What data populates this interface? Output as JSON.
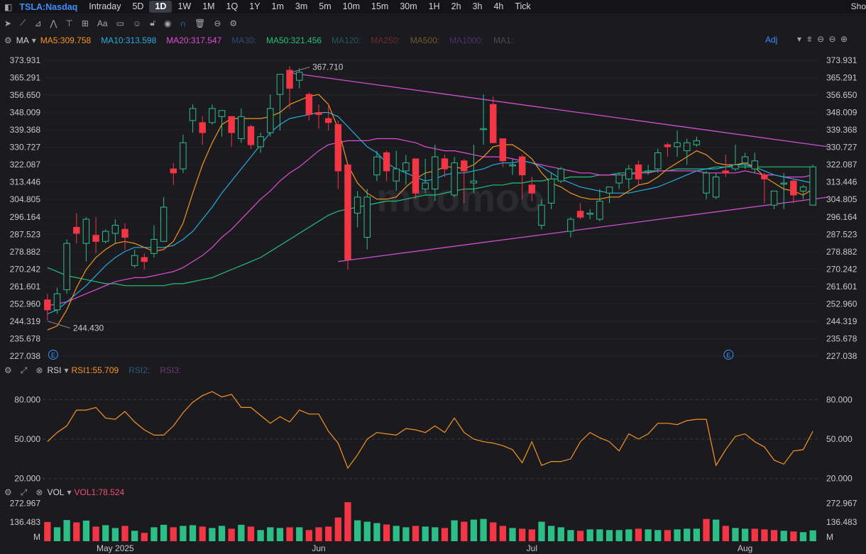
{
  "header": {
    "symbol": "TSLA:Nasdaq",
    "timeframes": [
      "Intraday",
      "5D",
      "1D",
      "1W",
      "1M",
      "1Q",
      "1Y",
      "1m",
      "3m",
      "5m",
      "10m",
      "15m",
      "30m",
      "1H",
      "2h",
      "3h",
      "4h",
      "Tick"
    ],
    "active_timeframe": "1D",
    "right_text": "Sho"
  },
  "toolbar_icons": [
    "cursor-icon",
    "line-draw-icon",
    "fib-icon",
    "pattern-icon",
    "measure-icon",
    "text-icon",
    "note-icon",
    "smile-icon",
    "lock-icon",
    "eye-icon",
    "magnet-icon",
    "trash-icon",
    "link-icon",
    "settings-icon"
  ],
  "toolbar_text_label": "Aa",
  "ma_bar": {
    "name": "MA",
    "items": [
      {
        "label": "MA5:309.758",
        "color": "#f7931e"
      },
      {
        "label": "MA10:313.598",
        "color": "#29a9e0"
      },
      {
        "label": "MA20:317.547",
        "color": "#e24bd8"
      },
      {
        "label": "MA30:",
        "color": "#2c4a78"
      },
      {
        "label": "MA50:321.456",
        "color": "#22c07a"
      },
      {
        "label": "MA120:",
        "color": "#1f5a57"
      },
      {
        "label": "MA250:",
        "color": "#6a2b2b"
      },
      {
        "label": "MA500:",
        "color": "#6b5a28"
      },
      {
        "label": "MA1000:",
        "color": "#4a2f6e"
      },
      {
        "label": "MA1:",
        "color": "#4a4a50"
      }
    ],
    "adj_label": "Adj"
  },
  "rsi_bar": {
    "name": "RSI",
    "items": [
      {
        "label": "RSI1:55.709",
        "color": "#f7931e"
      },
      {
        "label": "RSI2:",
        "color": "#2c5a7a"
      },
      {
        "label": "RSI3:",
        "color": "#6a3a6a"
      }
    ]
  },
  "vol_bar": {
    "name": "VOL",
    "items": [
      {
        "label": "VOL1:78.524",
        "color": "#f0506e"
      }
    ]
  },
  "watermark": "moomoo",
  "event_marker": "E",
  "chart_data": {
    "type": "candlestick",
    "price_axis_ticks": [
      "373.931",
      "365.291",
      "356.650",
      "348.009",
      "339.368",
      "330.727",
      "322.087",
      "313.446",
      "304.805",
      "296.164",
      "287.523",
      "278.882",
      "270.242",
      "261.601",
      "252.960",
      "244.319",
      "235.678",
      "227.038"
    ],
    "price_range": [
      227.038,
      373.931
    ],
    "annotations": {
      "high_label": "367.710",
      "low_label": "244.430"
    },
    "x_labels": [
      "May 2025",
      "Jun",
      "Jul",
      "Aug"
    ],
    "colors": {
      "up": "#2dbd86",
      "down": "#f23645",
      "ma5": "#f7931e",
      "ma10": "#29a9e0",
      "ma20": "#e24bd8",
      "ma50": "#22c07a",
      "trend": "#d04fd4"
    },
    "candles": [
      [
        255,
        250,
        258,
        245
      ],
      [
        250,
        258,
        261,
        248
      ],
      [
        260,
        283,
        285,
        258
      ],
      [
        291,
        288,
        298,
        283
      ],
      [
        283,
        295,
        296,
        274
      ],
      [
        287,
        284,
        296,
        278
      ],
      [
        284,
        289,
        290,
        283
      ],
      [
        288,
        292,
        295,
        283
      ],
      [
        290,
        286,
        293,
        280
      ],
      [
        272,
        277,
        280,
        271
      ],
      [
        276,
        274,
        278,
        270
      ],
      [
        278,
        285,
        292,
        276
      ],
      [
        284,
        301,
        306,
        284
      ],
      [
        320,
        318,
        323,
        312
      ],
      [
        320,
        333,
        337,
        318
      ],
      [
        344,
        350,
        352,
        338
      ],
      [
        343,
        338,
        346,
        332
      ],
      [
        343,
        350,
        352,
        342
      ],
      [
        346,
        349,
        349,
        336
      ],
      [
        346,
        338,
        345,
        331
      ],
      [
        335,
        346,
        350,
        333
      ],
      [
        341,
        332,
        342,
        330
      ],
      [
        331,
        336,
        338,
        328
      ],
      [
        338,
        350,
        357,
        336
      ],
      [
        357,
        367,
        367,
        339
      ],
      [
        369,
        360,
        371,
        350
      ],
      [
        364,
        368,
        370,
        360
      ],
      [
        357,
        347,
        358,
        344
      ],
      [
        348,
        347,
        352,
        340
      ],
      [
        345,
        343,
        352,
        339
      ],
      [
        342,
        319,
        344,
        310
      ],
      [
        322,
        275,
        322,
        270
      ],
      [
        298,
        306,
        309,
        291
      ],
      [
        286,
        306,
        310,
        280
      ],
      [
        317,
        326,
        329,
        314
      ],
      [
        328,
        319,
        329,
        314
      ],
      [
        314,
        320,
        329,
        309
      ],
      [
        319,
        323,
        327,
        312
      ],
      [
        325,
        308,
        325,
        305
      ],
      [
        310,
        313,
        325,
        308
      ],
      [
        310,
        326,
        332,
        304
      ],
      [
        325,
        320,
        327,
        316
      ],
      [
        307,
        323,
        326,
        306
      ],
      [
        324,
        319,
        325,
        303
      ],
      [
        313,
        314,
        332,
        308
      ],
      [
        340,
        340,
        357,
        332
      ],
      [
        352,
        333,
        356,
        333
      ],
      [
        335,
        324,
        335,
        321
      ],
      [
        322,
        322,
        325,
        317
      ],
      [
        326,
        317,
        327,
        305
      ],
      [
        312,
        308,
        316,
        304
      ],
      [
        292,
        302,
        305,
        290
      ],
      [
        303,
        315,
        318,
        300
      ],
      [
        314,
        320,
        321,
        313
      ],
      [
        289,
        295,
        296,
        286
      ],
      [
        299,
        296,
        303,
        295
      ],
      [
        298,
        298,
        300,
        295
      ],
      [
        295,
        304,
        310,
        294
      ],
      [
        308,
        311,
        311,
        303
      ],
      [
        313,
        317,
        318,
        310
      ],
      [
        315,
        320,
        322,
        310
      ],
      [
        322,
        315,
        324,
        312
      ],
      [
        319,
        319,
        322,
        317
      ],
      [
        320,
        328,
        330,
        318
      ],
      [
        332,
        331,
        333,
        326
      ],
      [
        331,
        333,
        339,
        326
      ],
      [
        329,
        333,
        335,
        322
      ],
      [
        332,
        334,
        336,
        331
      ],
      [
        308,
        318,
        319,
        305
      ],
      [
        306,
        316,
        318,
        305
      ],
      [
        319,
        318,
        327,
        316
      ],
      [
        320,
        322,
        332,
        319
      ],
      [
        323,
        326,
        328,
        320
      ],
      [
        320,
        324,
        328,
        318
      ],
      [
        317,
        315,
        318,
        303
      ],
      [
        302,
        309,
        309,
        300
      ],
      [
        313,
        313,
        318,
        300
      ],
      [
        314,
        307,
        315,
        303
      ],
      [
        309,
        311,
        312,
        305
      ],
      [
        302,
        321,
        322,
        302
      ]
    ],
    "ma_series": {
      "ma5": [
        240,
        242,
        250,
        261,
        270,
        276,
        280,
        283,
        284,
        283,
        281,
        279,
        280,
        284,
        293,
        308,
        322,
        333,
        342,
        345,
        345,
        345,
        345,
        346,
        348,
        352,
        354,
        356,
        357,
        352,
        340,
        322,
        313,
        308,
        305,
        305,
        306,
        311,
        315,
        318,
        319,
        321,
        321,
        320,
        322,
        326,
        331,
        332,
        332,
        329,
        325,
        318,
        313,
        311,
        308,
        306,
        305,
        305,
        306,
        306,
        309,
        312,
        313,
        316,
        320,
        323,
        326,
        329,
        327,
        323,
        322,
        322,
        323,
        321,
        316,
        313,
        310,
        309,
        307,
        310
      ],
      "ma10": [
        248,
        250,
        254,
        258,
        262,
        267,
        272,
        276,
        279,
        281,
        281,
        281,
        281,
        282,
        285,
        289,
        295,
        301,
        308,
        314,
        320,
        326,
        332,
        338,
        342,
        345,
        346,
        347,
        348,
        348,
        346,
        341,
        336,
        331,
        328,
        323,
        320,
        318,
        316,
        314,
        315,
        317,
        318,
        318,
        319,
        320,
        322,
        323,
        323,
        324,
        323,
        321,
        318,
        315,
        313,
        311,
        310,
        309,
        308,
        308,
        308,
        309,
        310,
        311,
        313,
        315,
        317,
        319,
        320,
        320,
        321,
        322,
        322,
        321,
        319,
        317,
        316,
        315,
        314,
        313
      ],
      "ma20": [
        252,
        253,
        254,
        256,
        258,
        260,
        262,
        264,
        265,
        266,
        266,
        267,
        268,
        269,
        271,
        274,
        277,
        281,
        286,
        290,
        295,
        300,
        305,
        309,
        314,
        318,
        321,
        325,
        329,
        332,
        333,
        334,
        334,
        334,
        335,
        335,
        335,
        334,
        333,
        331,
        330,
        329,
        329,
        328,
        327,
        326,
        326,
        326,
        325,
        324,
        323,
        322,
        321,
        320,
        319,
        318,
        318,
        317,
        317,
        317,
        317,
        318,
        318,
        319,
        319,
        319,
        319,
        319,
        318,
        318,
        318,
        318,
        319,
        318,
        317,
        317,
        316,
        316,
        316,
        317
      ],
      "ma50": [
        271,
        269,
        267,
        266,
        265,
        264,
        263,
        263,
        262,
        262,
        262,
        262,
        262,
        263,
        263,
        264,
        265,
        266,
        268,
        270,
        272,
        274,
        276,
        279,
        282,
        285,
        288,
        291,
        294,
        297,
        299,
        300,
        301,
        302,
        303,
        304,
        304,
        305,
        306,
        307,
        307,
        308,
        309,
        310,
        310,
        311,
        312,
        312,
        313,
        313,
        314,
        314,
        315,
        315,
        316,
        316,
        316,
        317,
        317,
        318,
        318,
        318,
        319,
        319,
        319,
        320,
        320,
        320,
        320,
        321,
        321,
        321,
        321,
        321,
        321,
        321,
        321,
        321,
        321,
        321
      ]
    },
    "trendlines": [
      {
        "from": [
          25,
          367.71
        ],
        "to": [
          80,
          331.0
        ]
      },
      {
        "from": [
          30,
          274.0
        ],
        "to": [
          80,
          306.0
        ]
      }
    ],
    "rsi": {
      "ticks": [
        "80.000",
        "50.000",
        "20.000"
      ],
      "range": [
        15,
        92
      ],
      "values": [
        48,
        55,
        60,
        72,
        72,
        74,
        66,
        65,
        71,
        63,
        57,
        53,
        53,
        60,
        70,
        78,
        83,
        86,
        82,
        84,
        74,
        74,
        68,
        62,
        67,
        63,
        72,
        69,
        69,
        56,
        47,
        28,
        38,
        50,
        55,
        54,
        53,
        58,
        57,
        55,
        60,
        55,
        66,
        55,
        50,
        48,
        47,
        45,
        42,
        32,
        48,
        30,
        33,
        33,
        35,
        48,
        55,
        51,
        48,
        41,
        54,
        50,
        54,
        62,
        62,
        61,
        64,
        65,
        65,
        30,
        42,
        52,
        54,
        48,
        44,
        34,
        31,
        41,
        42,
        56
      ]
    },
    "volume": {
      "ticks": [
        "272.967",
        "136.483"
      ],
      "unit": "M",
      "range": [
        0,
        290
      ],
      "values": [
        138,
        100,
        152,
        135,
        148,
        105,
        115,
        95,
        110,
        75,
        60,
        100,
        118,
        100,
        110,
        115,
        105,
        95,
        110,
        90,
        118,
        105,
        80,
        100,
        95,
        100,
        100,
        80,
        100,
        105,
        170,
        280,
        150,
        140,
        130,
        120,
        110,
        100,
        110,
        105,
        100,
        95,
        150,
        140,
        155,
        160,
        135,
        110,
        95,
        90,
        85,
        140,
        110,
        100,
        80,
        75,
        85,
        85,
        80,
        80,
        85,
        90,
        85,
        80,
        80,
        85,
        90,
        90,
        160,
        155,
        110,
        95,
        90,
        90,
        85,
        80,
        75,
        70,
        65,
        78
      ],
      "up_flags": [
        0,
        1,
        1,
        0,
        1,
        0,
        1,
        1,
        0,
        1,
        0,
        1,
        1,
        0,
        1,
        1,
        0,
        1,
        1,
        0,
        1,
        0,
        1,
        1,
        1,
        0,
        1,
        0,
        0,
        0,
        0,
        0,
        1,
        1,
        1,
        0,
        1,
        1,
        0,
        1,
        1,
        0,
        1,
        0,
        1,
        1,
        0,
        0,
        1,
        0,
        0,
        1,
        1,
        1,
        1,
        0,
        1,
        1,
        1,
        1,
        1,
        0,
        1,
        1,
        0,
        1,
        1,
        1,
        0,
        1,
        0,
        1,
        1,
        0,
        0,
        0,
        1,
        0,
        1,
        1
      ]
    }
  }
}
